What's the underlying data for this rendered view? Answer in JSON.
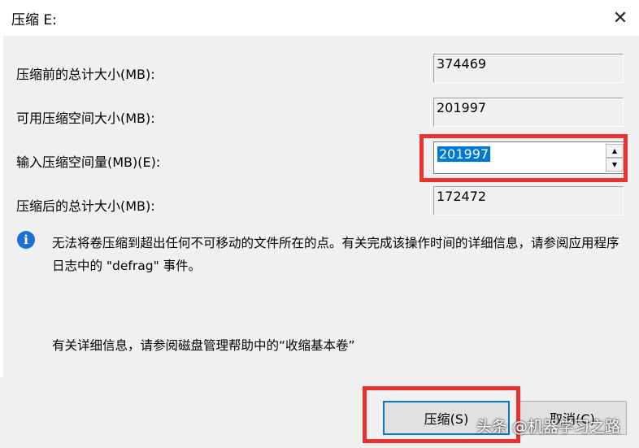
{
  "window": {
    "title": "压缩 E:"
  },
  "fields": {
    "total_before_label": "压缩前的总计大小(MB):",
    "total_before_value": "374469",
    "available_label": "可用压缩空间大小(MB):",
    "available_value": "201997",
    "amount_label": "输入压缩空间量(MB)(E):",
    "amount_value": "201997",
    "total_after_label": "压缩后的总计大小(MB):",
    "total_after_value": "172472"
  },
  "info": {
    "icon": "info-icon",
    "message": "无法将卷压缩到超出任何不可移动的文件所在的点。有关完成该操作时间的详细信息，请参阅应用程序日志中的 \"defrag\" 事件。",
    "help": "有关详细信息，请参阅磁盘管理帮助中的“收缩基本卷”"
  },
  "buttons": {
    "shrink": "压缩(S)",
    "cancel": "取消(C)"
  },
  "watermark": "头条 @机器学习之路",
  "colors": {
    "highlight": "#e8322e",
    "selection": "#0078d7",
    "info": "#1f6fd1"
  }
}
